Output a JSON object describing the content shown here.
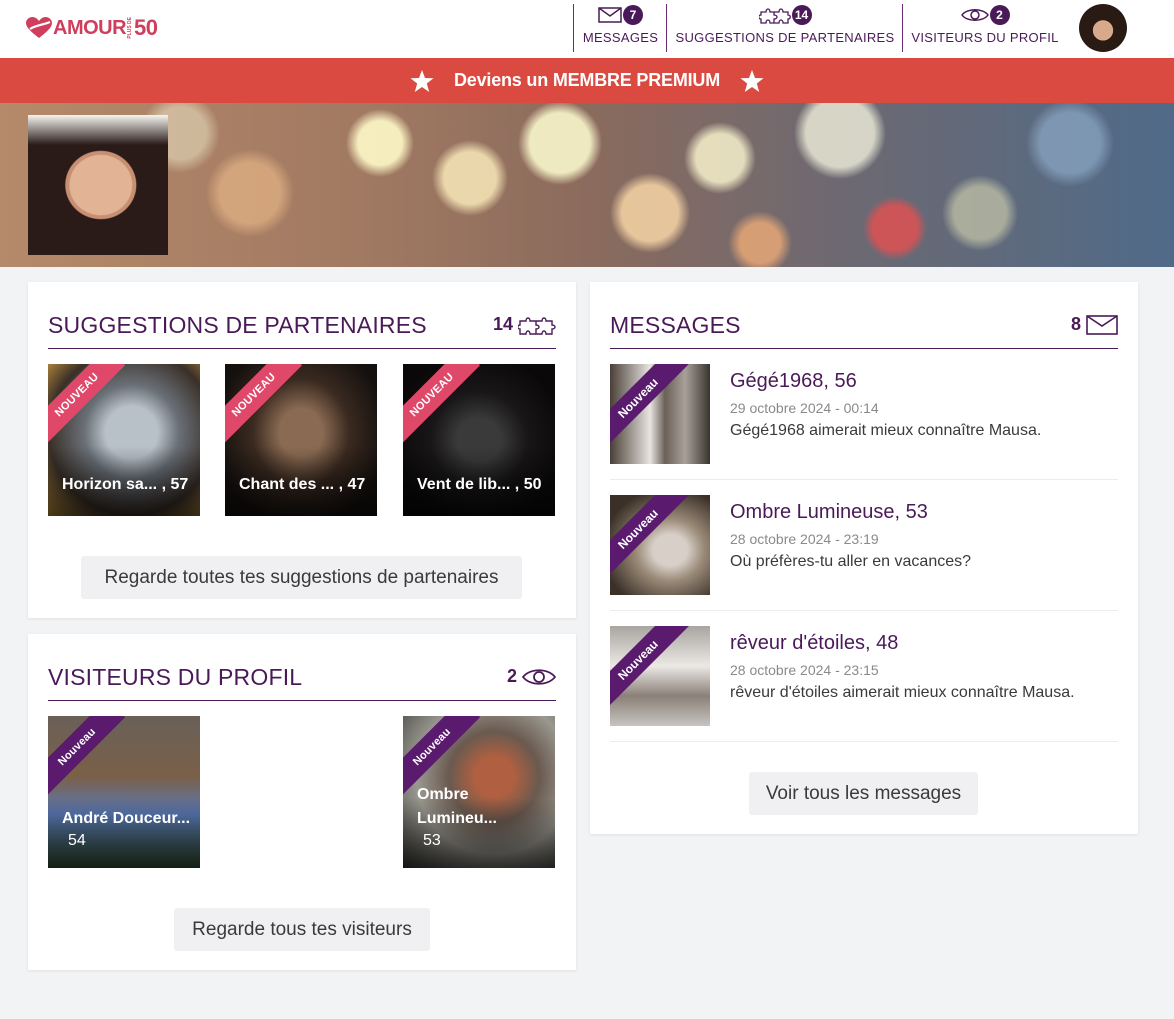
{
  "brand": {
    "logo_text": "AMOUR",
    "logo_plus": "PLUS DE",
    "logo_number": "50"
  },
  "nav": {
    "messages": {
      "label": "MESSAGES",
      "badge": "7"
    },
    "suggestions": {
      "label": "SUGGESTIONS DE PARTENAIRES",
      "badge": "14"
    },
    "visitors": {
      "label": "VISITEURS DU PROFIL",
      "badge": "2"
    }
  },
  "premium": {
    "label": "Deviens un MEMBRE PREMIUM"
  },
  "suggestions": {
    "title": "SUGGESTIONS DE PARTENAIRES",
    "count": "14",
    "items": [
      {
        "badge": "NOUVEAU",
        "name": "Horizon sa... , 57"
      },
      {
        "badge": "NOUVEAU",
        "name": "Chant des ... , 47"
      },
      {
        "badge": "NOUVEAU",
        "name": "Vent de lib... , 50"
      }
    ],
    "button": "Regarde toutes tes suggestions de partenaires"
  },
  "visitors": {
    "title": "VISITEURS DU PROFIL",
    "count": "2",
    "items": [
      {
        "badge": "Nouveau",
        "name": "André Douceur...",
        "age": "54"
      },
      {
        "badge": "Nouveau",
        "name_line1": "Ombre",
        "name_line2": "Lumineu...",
        "age": "53"
      }
    ],
    "button": "Regarde tous tes visiteurs"
  },
  "messages": {
    "title": "MESSAGES",
    "count": "8",
    "items": [
      {
        "badge": "Nouveau",
        "name": "Gégé1968, 56",
        "date": "29 octobre 2024 - 00:14",
        "text": "Gégé1968 aimerait mieux connaître Mausa."
      },
      {
        "badge": "Nouveau",
        "name": "Ombre Lumineuse, 53",
        "date": "28 octobre 2024 - 23:19",
        "text": "Où préfères-tu aller en vacances?"
      },
      {
        "badge": "Nouveau",
        "name": "rêveur d'étoiles, 48",
        "date": "28 octobre 2024 - 23:15",
        "text": "rêveur d'étoiles aimerait mieux connaître Mausa."
      }
    ],
    "button": "Voir tous les messages"
  },
  "colors": {
    "accent": "#4a1a58",
    "premium": "#da4a40",
    "brand": "#d03e5d",
    "ribbon_pink": "#e0486a",
    "ribbon_purple": "#5a1a6e"
  },
  "icons": [
    "envelope-icon",
    "puzzle-icon",
    "eye-icon",
    "star-icon",
    "heart-logo-icon"
  ]
}
